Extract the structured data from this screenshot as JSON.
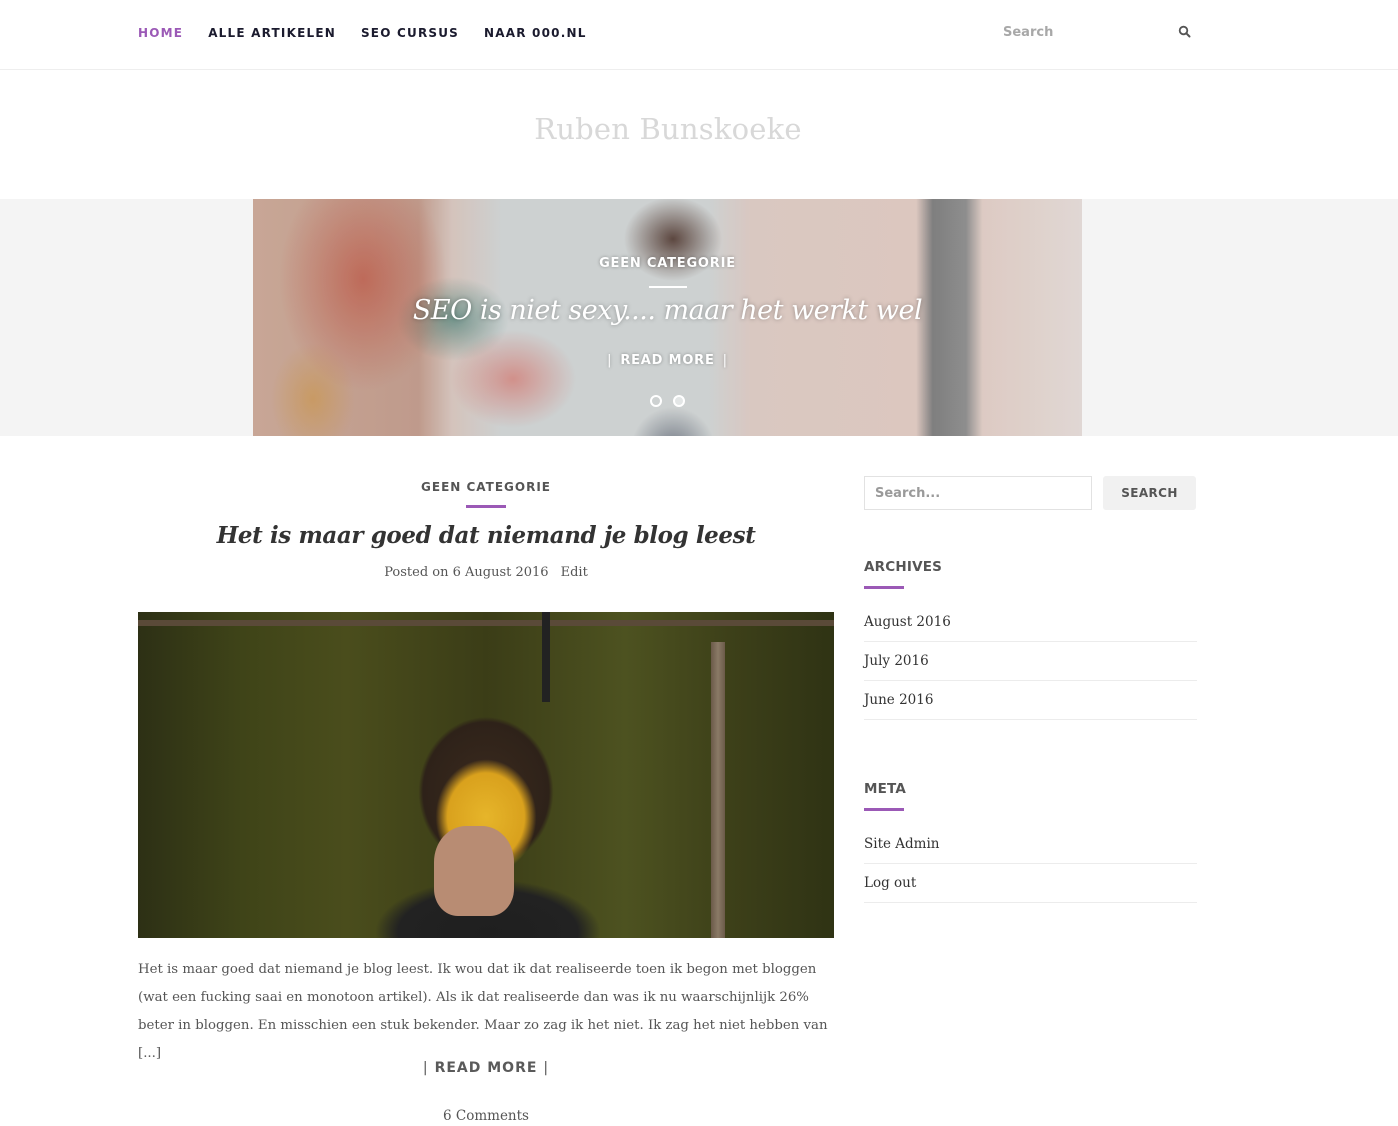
{
  "nav": {
    "items": [
      {
        "label": "HOME",
        "active": true
      },
      {
        "label": "ALLE ARTIKELEN",
        "active": false
      },
      {
        "label": "SEO CURSUS",
        "active": false
      },
      {
        "label": "NAAR 000.NL",
        "active": false
      }
    ],
    "search_placeholder": "Search",
    "search_icon": "search-icon"
  },
  "site": {
    "title": "Ruben Bunskoeke"
  },
  "hero": {
    "category": "GEEN CATEGORIE",
    "title": "SEO is niet sexy.... maar het werkt wel",
    "read_more": "READ MORE",
    "bar": "|",
    "slides": 2,
    "active_slide": 2
  },
  "post": {
    "category": "GEEN CATEGORIE",
    "title": "Het is maar goed dat niemand je blog leest",
    "posted_on": "Posted on 6 August 2016",
    "edit": "Edit",
    "excerpt": "Het is maar goed dat niemand je blog leest. Ik wou dat ik dat realiseerde toen ik begon met bloggen (wat een fucking saai en monotoon artikel). Als ik dat realiseerde dan was ik nu waarschijnlijk 26% beter in bloggen. En misschien een stuk bekender. Maar zo zag ik het niet. Ik zag het niet hebben van [...]",
    "read_more": "READ MORE",
    "bar": "|",
    "comments": "6 Comments"
  },
  "sidebar": {
    "search_placeholder": "Search...",
    "search_button": "SEARCH",
    "archives": {
      "title": "ARCHIVES",
      "items": [
        "August 2016",
        "July 2016",
        "June 2016"
      ]
    },
    "meta": {
      "title": "META",
      "items": [
        "Site Admin",
        "Log out"
      ]
    }
  },
  "colors": {
    "accent": "#9b59b6",
    "nav_text": "#1b1b2e",
    "body_text": "#555555",
    "site_title": "#d8d8d8"
  }
}
